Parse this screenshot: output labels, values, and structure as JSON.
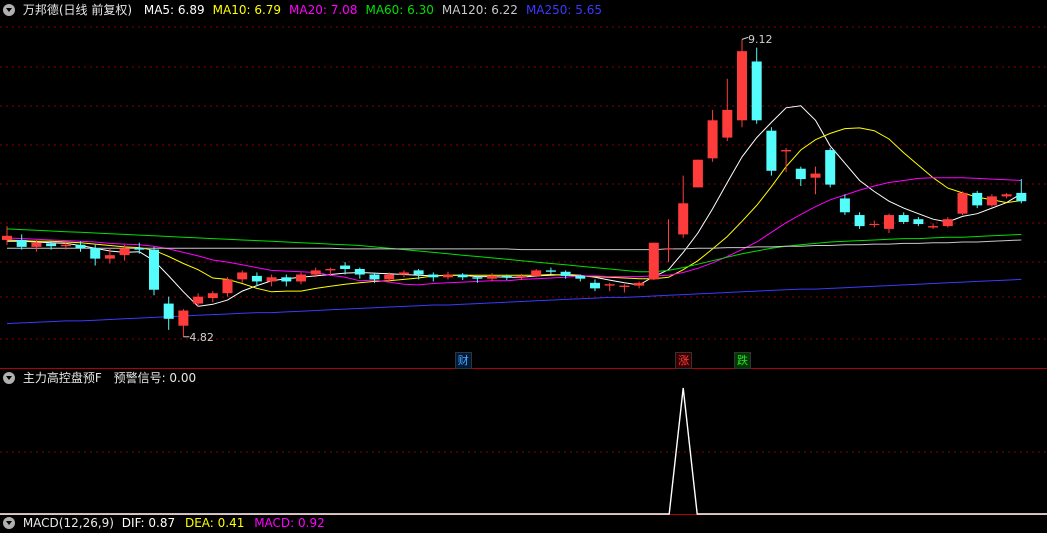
{
  "header": {
    "title": "万邦德(日线 前复权)",
    "ma": [
      {
        "label": "MA5: 6.89",
        "color": "#ffffff"
      },
      {
        "label": "MA10: 6.79",
        "color": "#ffff00"
      },
      {
        "label": "MA20: 7.08",
        "color": "#ff00ff"
      },
      {
        "label": "MA60: 6.30",
        "color": "#00e000"
      },
      {
        "label": "MA120: 6.22",
        "color": "#c8c8c8"
      },
      {
        "label": "MA250: 5.65",
        "color": "#3a3aff"
      }
    ]
  },
  "indicator": {
    "title": "主力高控盘预F",
    "signal": "预警信号: 0.00"
  },
  "macd": {
    "title": "MACD(12,26,9)",
    "dif": "DIF: 0.87",
    "dea": "DEA: 0.41",
    "macd": "MACD: 0.92"
  },
  "annotations": {
    "high": "9.12",
    "low": "4.82"
  },
  "events": [
    {
      "label": "财",
      "color": "#4aa8ff",
      "bg": "#001a3a"
    },
    {
      "label": "涨",
      "color": "#ff4040",
      "bg": "#3a0000"
    },
    {
      "label": "跌",
      "color": "#30e030",
      "bg": "#003a00"
    }
  ],
  "colors": {
    "up": "#ff3c3c",
    "down": "#54fcfc",
    "grid": "#8b0000",
    "axis": "#b00000",
    "signal": "#ffffff"
  },
  "chart_data": {
    "type": "candlestick",
    "y_range": [
      4.6,
      9.4
    ],
    "candles": [
      [
        6.22,
        6.28,
        6.15,
        6.42
      ],
      [
        6.22,
        6.12,
        6.08,
        6.3
      ],
      [
        6.12,
        6.18,
        6.05,
        6.22
      ],
      [
        6.17,
        6.13,
        6.08,
        6.2
      ],
      [
        6.13,
        6.15,
        6.08,
        6.19
      ],
      [
        6.15,
        6.1,
        6.05,
        6.2
      ],
      [
        6.1,
        5.95,
        5.85,
        6.15
      ],
      [
        5.95,
        6.0,
        5.88,
        6.1
      ],
      [
        6.0,
        6.1,
        5.92,
        6.15
      ],
      [
        6.1,
        6.08,
        6.02,
        6.18
      ],
      [
        6.08,
        5.5,
        5.42,
        6.12
      ],
      [
        5.3,
        5.08,
        4.92,
        5.4
      ],
      [
        4.98,
        5.2,
        4.82,
        5.22
      ],
      [
        5.3,
        5.4,
        5.25,
        5.45
      ],
      [
        5.38,
        5.45,
        5.32,
        5.48
      ],
      [
        5.45,
        5.65,
        5.4,
        5.68
      ],
      [
        5.65,
        5.75,
        5.6,
        5.78
      ],
      [
        5.7,
        5.62,
        5.55,
        5.75
      ],
      [
        5.62,
        5.68,
        5.55,
        5.72
      ],
      [
        5.68,
        5.62,
        5.55,
        5.72
      ],
      [
        5.62,
        5.72,
        5.58,
        5.75
      ],
      [
        5.72,
        5.78,
        5.68,
        5.82
      ],
      [
        5.78,
        5.8,
        5.7,
        5.82
      ],
      [
        5.85,
        5.8,
        5.72,
        5.9
      ],
      [
        5.8,
        5.72,
        5.66,
        5.82
      ],
      [
        5.72,
        5.65,
        5.6,
        5.75
      ],
      [
        5.65,
        5.72,
        5.62,
        5.75
      ],
      [
        5.72,
        5.75,
        5.68,
        5.78
      ],
      [
        5.78,
        5.72,
        5.65,
        5.8
      ],
      [
        5.72,
        5.68,
        5.62,
        5.75
      ],
      [
        5.68,
        5.72,
        5.65,
        5.76
      ],
      [
        5.72,
        5.68,
        5.64,
        5.74
      ],
      [
        5.68,
        5.66,
        5.6,
        5.7
      ],
      [
        5.66,
        5.7,
        5.62,
        5.74
      ],
      [
        5.7,
        5.68,
        5.64,
        5.72
      ],
      [
        5.68,
        5.7,
        5.64,
        5.73
      ],
      [
        5.7,
        5.78,
        5.68,
        5.8
      ],
      [
        5.78,
        5.76,
        5.72,
        5.82
      ],
      [
        5.76,
        5.7,
        5.66,
        5.78
      ],
      [
        5.7,
        5.66,
        5.62,
        5.72
      ],
      [
        5.6,
        5.52,
        5.48,
        5.65
      ],
      [
        5.56,
        5.58,
        5.48,
        5.6
      ],
      [
        5.54,
        5.56,
        5.46,
        5.58
      ],
      [
        5.56,
        5.6,
        5.52,
        5.62
      ],
      [
        5.65,
        6.18,
        5.64,
        6.18
      ],
      [
        6.1,
        6.1,
        5.9,
        6.52
      ],
      [
        6.3,
        6.75,
        6.25,
        7.15
      ],
      [
        6.98,
        7.38,
        6.98,
        7.38
      ],
      [
        7.4,
        7.95,
        7.35,
        8.1
      ],
      [
        7.7,
        8.1,
        7.65,
        8.55
      ],
      [
        7.95,
        8.95,
        7.85,
        9.12
      ],
      [
        8.8,
        7.95,
        7.9,
        9.0
      ],
      [
        7.8,
        7.22,
        7.15,
        7.85
      ],
      [
        7.5,
        7.52,
        7.2,
        7.55
      ],
      [
        7.25,
        7.1,
        7.0,
        7.28
      ],
      [
        7.12,
        7.18,
        6.88,
        7.28
      ],
      [
        7.52,
        7.02,
        6.98,
        7.55
      ],
      [
        6.82,
        6.62,
        6.58,
        6.88
      ],
      [
        6.58,
        6.42,
        6.38,
        6.62
      ],
      [
        6.45,
        6.45,
        6.4,
        6.5
      ],
      [
        6.38,
        6.58,
        6.32,
        6.6
      ],
      [
        6.58,
        6.48,
        6.45,
        6.62
      ],
      [
        6.52,
        6.45,
        6.42,
        6.55
      ],
      [
        6.4,
        6.42,
        6.38,
        6.46
      ],
      [
        6.42,
        6.52,
        6.4,
        6.55
      ],
      [
        6.6,
        6.9,
        6.58,
        6.92
      ],
      [
        6.9,
        6.72,
        6.68,
        6.93
      ],
      [
        6.72,
        6.85,
        6.7,
        6.88
      ],
      [
        6.85,
        6.88,
        6.82,
        6.9
      ],
      [
        6.9,
        6.78,
        6.75,
        7.1
      ]
    ],
    "ma_lines": [
      {
        "name": "MA5",
        "color": "#ffffff",
        "values": [
          6.2,
          6.2,
          6.19,
          6.18,
          6.17,
          6.14,
          6.1,
          6.06,
          6.04,
          6.05,
          5.92,
          5.7,
          5.47,
          5.26,
          5.29,
          5.35,
          5.48,
          5.56,
          5.63,
          5.66,
          5.68,
          5.7,
          5.72,
          5.74,
          5.75,
          5.74,
          5.73,
          5.72,
          5.71,
          5.7,
          5.71,
          5.71,
          5.69,
          5.69,
          5.68,
          5.68,
          5.7,
          5.71,
          5.72,
          5.71,
          5.68,
          5.64,
          5.6,
          5.57,
          5.69,
          5.79,
          6.04,
          6.32,
          6.67,
          7.05,
          7.42,
          7.7,
          7.92,
          8.13,
          8.16,
          7.95,
          7.58,
          7.33,
          7.08,
          6.92,
          6.78,
          6.68,
          6.6,
          6.52,
          6.48,
          6.56,
          6.6,
          6.68,
          6.76,
          6.89
        ]
      },
      {
        "name": "MA10",
        "color": "#ffff00",
        "values": [
          6.22,
          6.21,
          6.2,
          6.2,
          6.19,
          6.18,
          6.16,
          6.14,
          6.12,
          6.11,
          6.07,
          5.98,
          5.88,
          5.79,
          5.67,
          5.65,
          5.59,
          5.52,
          5.47,
          5.48,
          5.48,
          5.52,
          5.55,
          5.58,
          5.6,
          5.62,
          5.63,
          5.65,
          5.67,
          5.7,
          5.71,
          5.71,
          5.71,
          5.71,
          5.71,
          5.71,
          5.71,
          5.72,
          5.71,
          5.7,
          5.69,
          5.68,
          5.67,
          5.66,
          5.66,
          5.68,
          5.79,
          5.92,
          6.09,
          6.27,
          6.49,
          6.72,
          6.99,
          7.28,
          7.52,
          7.67,
          7.76,
          7.83,
          7.84,
          7.8,
          7.68,
          7.48,
          7.3,
          7.12,
          6.97,
          6.9,
          6.84,
          6.8,
          6.76,
          6.79
        ]
      },
      {
        "name": "MA20",
        "color": "#ff00ff",
        "values": [
          6.25,
          6.24,
          6.23,
          6.22,
          6.21,
          6.2,
          6.19,
          6.17,
          6.16,
          6.15,
          6.13,
          6.09,
          6.04,
          5.99,
          5.93,
          5.9,
          5.86,
          5.82,
          5.78,
          5.77,
          5.76,
          5.75,
          5.71,
          5.68,
          5.63,
          5.64,
          5.61,
          5.58,
          5.57,
          5.59,
          5.6,
          5.61,
          5.62,
          5.63,
          5.63,
          5.65,
          5.66,
          5.67,
          5.68,
          5.7,
          5.7,
          5.69,
          5.69,
          5.69,
          5.7,
          5.71,
          5.75,
          5.81,
          5.89,
          5.98,
          6.08,
          6.19,
          6.33,
          6.47,
          6.59,
          6.7,
          6.8,
          6.87,
          6.94,
          7.0,
          7.05,
          7.08,
          7.11,
          7.12,
          7.12,
          7.12,
          7.11,
          7.1,
          7.09,
          7.08
        ]
      },
      {
        "name": "MA60",
        "color": "#00e000",
        "values": [
          6.38,
          6.37,
          6.36,
          6.35,
          6.34,
          6.33,
          6.32,
          6.31,
          6.3,
          6.29,
          6.28,
          6.27,
          6.26,
          6.25,
          6.24,
          6.23,
          6.22,
          6.21,
          6.2,
          6.19,
          6.18,
          6.17,
          6.16,
          6.15,
          6.14,
          6.12,
          6.1,
          6.08,
          6.06,
          6.04,
          6.02,
          6.0,
          5.98,
          5.96,
          5.94,
          5.92,
          5.9,
          5.88,
          5.86,
          5.84,
          5.82,
          5.8,
          5.78,
          5.76,
          5.76,
          5.78,
          5.82,
          5.87,
          5.92,
          5.97,
          6.02,
          6.06,
          6.1,
          6.13,
          6.15,
          6.17,
          6.19,
          6.2,
          6.21,
          6.22,
          6.23,
          6.24,
          6.24,
          6.25,
          6.26,
          6.26,
          6.27,
          6.28,
          6.29,
          6.3
        ]
      },
      {
        "name": "MA120",
        "color": "#c8c8c8",
        "values": [
          6.1,
          6.1,
          6.1,
          6.1,
          6.1,
          6.1,
          6.1,
          6.1,
          6.1,
          6.1,
          6.1,
          6.1,
          6.1,
          6.1,
          6.1,
          6.1,
          6.1,
          6.1,
          6.1,
          6.1,
          6.1,
          6.1,
          6.1,
          6.09,
          6.09,
          6.09,
          6.09,
          6.09,
          6.09,
          6.09,
          6.09,
          6.09,
          6.09,
          6.09,
          6.09,
          6.08,
          6.08,
          6.08,
          6.08,
          6.08,
          6.08,
          6.08,
          6.08,
          6.08,
          6.08,
          6.09,
          6.09,
          6.1,
          6.1,
          6.11,
          6.11,
          6.12,
          6.12,
          6.13,
          6.13,
          6.14,
          6.14,
          6.15,
          6.15,
          6.16,
          6.16,
          6.17,
          6.17,
          6.18,
          6.18,
          6.19,
          6.19,
          6.2,
          6.21,
          6.22
        ]
      },
      {
        "name": "MA250",
        "color": "#3a3aff",
        "values": [
          5.01,
          5.02,
          5.03,
          5.04,
          5.05,
          5.05,
          5.06,
          5.07,
          5.08,
          5.09,
          5.1,
          5.11,
          5.12,
          5.13,
          5.14,
          5.15,
          5.16,
          5.17,
          5.17,
          5.18,
          5.19,
          5.2,
          5.21,
          5.22,
          5.23,
          5.24,
          5.25,
          5.26,
          5.27,
          5.28,
          5.28,
          5.29,
          5.3,
          5.31,
          5.32,
          5.33,
          5.34,
          5.35,
          5.36,
          5.37,
          5.38,
          5.39,
          5.39,
          5.4,
          5.41,
          5.42,
          5.43,
          5.44,
          5.45,
          5.46,
          5.47,
          5.48,
          5.49,
          5.5,
          5.51,
          5.51,
          5.52,
          5.53,
          5.54,
          5.55,
          5.56,
          5.57,
          5.58,
          5.59,
          5.6,
          5.61,
          5.62,
          5.63,
          5.64,
          5.65
        ]
      }
    ],
    "signal_peak_index": 46,
    "event_indices": [
      31,
      46,
      50
    ]
  }
}
